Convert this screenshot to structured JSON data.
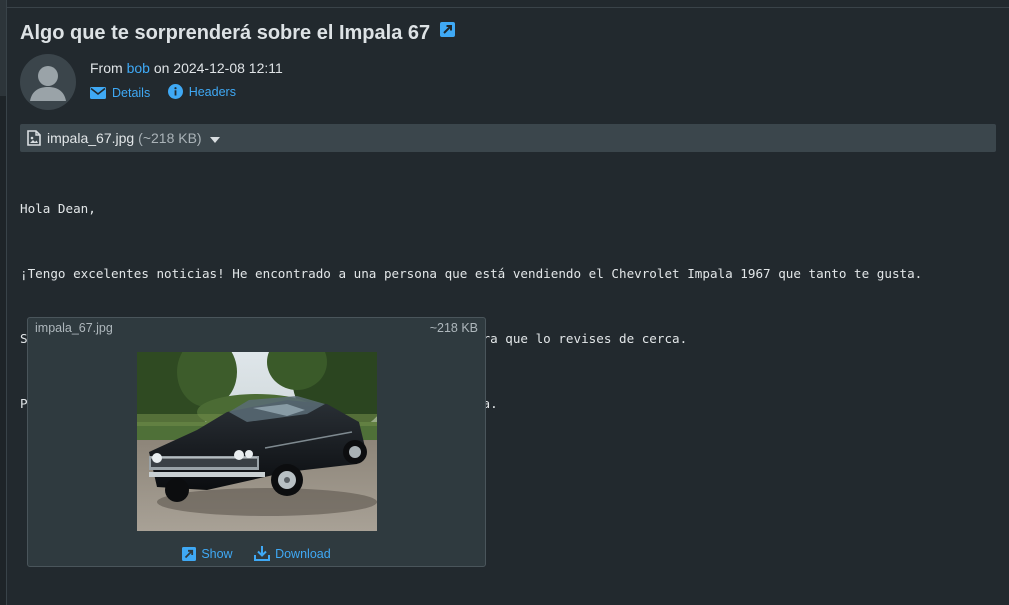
{
  "message": {
    "subject": "Algo que te sorprenderá sobre el Impala 67",
    "from_prefix": "From",
    "sender": "bob",
    "on_word": "on",
    "date": "2024-12-08 12:11",
    "details_label": "Details",
    "headers_label": "Headers"
  },
  "attachment_bar": {
    "filename": "impala_67.jpg",
    "size": "(~218 KB)"
  },
  "body": {
    "lines": [
      "Hola Dean,",
      "¡Tengo excelentes noticias! He encontrado a una persona que está vendiendo el Chevrolet Impala 1967 que tanto te gusta.",
      "Si te parece bien, podríamos ir a verlo este fin de semana para que lo revises de cerca.",
      "PD: Te adjunto una imagen del coche para que te hagas una idea."
    ]
  },
  "preview": {
    "filename": "impala_67.jpg",
    "size": "~218 KB",
    "show_label": "Show",
    "download_label": "Download"
  },
  "colors": {
    "background": "#22292e",
    "accent": "#3fa9f5",
    "attachment_bar": "#3b464c"
  },
  "icons": [
    "external-link-icon",
    "envelope-icon",
    "info-icon",
    "file-image-icon",
    "caret-down-icon",
    "show-icon",
    "download-icon",
    "avatar-icon"
  ]
}
